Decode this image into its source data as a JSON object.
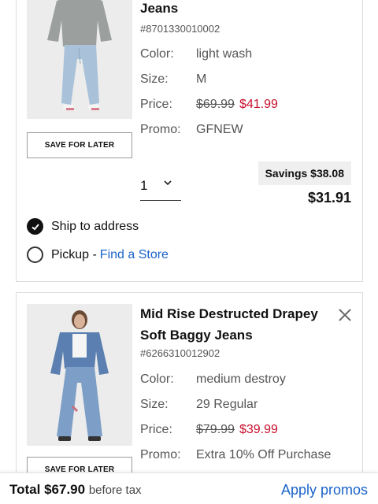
{
  "items": [
    {
      "title": "Jeans",
      "sku": "#8701330010002",
      "color_label": "Color:",
      "color": "light wash",
      "size_label": "Size:",
      "size": "M",
      "price_label": "Price:",
      "original_price": "$69.99",
      "sale_price": "$41.99",
      "promo_label": "Promo:",
      "promo": "GFNEW",
      "save_for_later": "SAVE FOR LATER",
      "quantity": "1",
      "savings": "Savings $38.08",
      "line_total": "$31.91",
      "ship_to_address": "Ship to address",
      "pickup": "Pickup - ",
      "find_store": "Find a Store"
    },
    {
      "title": "Mid Rise Destructed Drapey Soft Baggy Jeans",
      "sku": "#6266310012902",
      "color_label": "Color:",
      "color": "medium destroy",
      "size_label": "Size:",
      "size": "29 Regular",
      "price_label": "Price:",
      "original_price": "$79.99",
      "sale_price": "$39.99",
      "promo_label": "Promo:",
      "promo": "Extra 10% Off Purchase",
      "save_for_later": "SAVE FOR LATER"
    }
  ],
  "footer": {
    "total_label": "Total",
    "total": "$67.90",
    "before_tax": "before tax",
    "apply_promos": "Apply promos"
  },
  "colors": {
    "sale": "#c8102e",
    "link": "#1a63c9"
  },
  "icons": [
    "chevron-down-icon",
    "checkmark-icon",
    "close-icon"
  ]
}
